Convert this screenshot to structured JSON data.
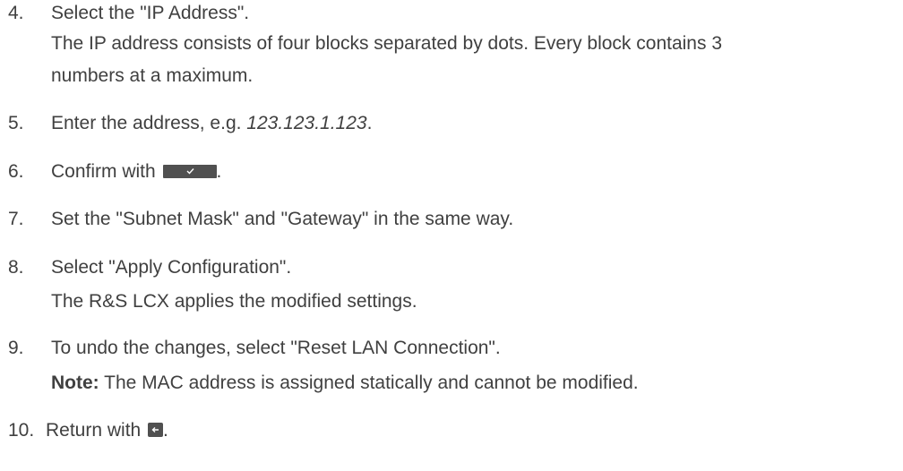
{
  "steps": [
    {
      "number": "4.",
      "lines": [
        "Select the \"IP Address\".",
        "The IP address consists of four blocks separated by dots. Every block contains 3",
        "numbers at a maximum."
      ]
    },
    {
      "number": "5.",
      "prefix": "Enter the address, e.g. ",
      "example": "123.123.1.123",
      "suffix": "."
    },
    {
      "number": "6.",
      "prefix": "Confirm with ",
      "key_icon": "confirm-checkmark-key-icon",
      "suffix": "."
    },
    {
      "number": "7.",
      "text": "Set the \"Subnet Mask\" and \"Gateway\" in the same way."
    },
    {
      "number": "8.",
      "text": "Select \"Apply Configuration\".",
      "result": "The R&S LCX applies the modified settings."
    },
    {
      "number": "9.",
      "text": "To undo the changes, select \"Reset LAN Connection\".",
      "note_label": "Note:",
      "note_text": " The MAC address is assigned statically and cannot be modified."
    },
    {
      "number": "10.",
      "prefix": "Return with ",
      "key_icon": "back-arrow-key-icon",
      "suffix": "."
    }
  ]
}
